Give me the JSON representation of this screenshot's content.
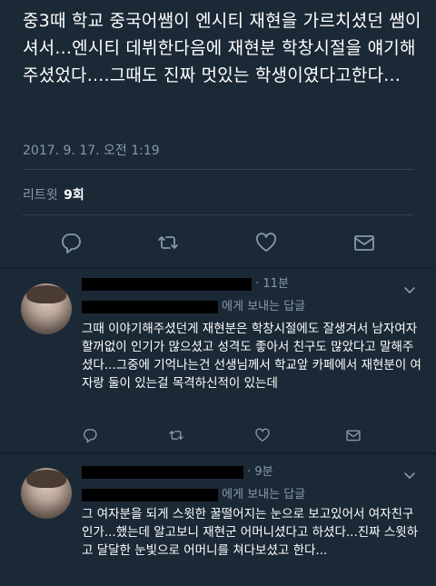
{
  "main_tweet": {
    "text": "중3때 학교 중국어쌤이 엔시티 재현을 가르치셨던 쌤이셔서...엔시티 데뷔한다음에 재현분 학창시절을 얘기해주셨었다....그때도 진짜 멋있는 학생이였다고한다...",
    "timestamp": "2017. 9. 17. 오전 1:19",
    "retweet_label": "리트윗",
    "retweet_count": "9회",
    "actions": [
      "reply-icon",
      "retweet-icon",
      "like-icon",
      "message-icon"
    ]
  },
  "replies": [
    {
      "time": "· 11분",
      "reply_to_suffix": "에게 보내는 답글",
      "text": "그때 이야기해주셨던게 재현분은 학창시절에도 잘생겨서 남자여자 할꺼없이 인기가 많으셨고 성격도 좋아서 친구도 많았다고 말해주셨다...그중에 기억나는건 선생님께서 학교앞 카페에서 재현분이 여자랑 둘이 있는걸 목격하신적이 있는데"
    },
    {
      "time": "· 9분",
      "reply_to_suffix": "에게 보내는 답글",
      "text": "그 여자분을 되게 스윗한 꿀떨어지는 눈으로 보고있어서 여자친구인가...했는데 알고보니 재현군 어머니셨다고 하셨다...진짜 스윗하고 달달한 눈빛으로 어머니를 쳐다보셨고 한다..."
    }
  ],
  "colors": {
    "background": "#141d26",
    "panel": "#1b2836",
    "secondary_text": "#8899a6",
    "divider": "#38444d",
    "link": "#1da1f2"
  }
}
